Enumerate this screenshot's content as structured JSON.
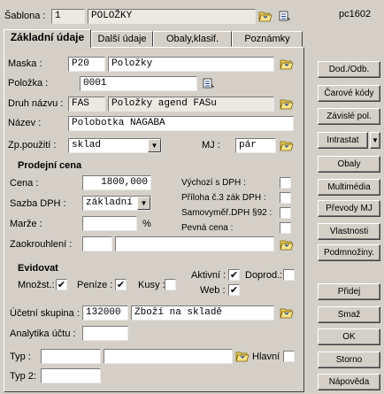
{
  "header": {
    "sablona_label": "Šablona :",
    "sablona_number": "1",
    "sablona_name": "POLOŽKY",
    "code": "pc1602"
  },
  "tabs": [
    {
      "label": "Základní údaje"
    },
    {
      "label": "Další údaje"
    },
    {
      "label": "Obaly,klasif."
    },
    {
      "label": "Poznámky"
    }
  ],
  "form": {
    "maska_label": "Maska :",
    "maska_code": "P20",
    "maska_name": "Položky",
    "polozka_label": "Položka :",
    "polozka_value": "0001",
    "druh_label": "Druh názvu :",
    "druh_code": "FAS",
    "druh_name": "Položky agend FASu",
    "nazev_label": "Název :",
    "nazev_value": "Polobotka NAGABA",
    "zp_pouziti_label": "Zp.použití :",
    "zp_pouziti_value": "sklad",
    "mj_label": "MJ :",
    "mj_value": "pár"
  },
  "prodejni_cena": {
    "title": "Prodejní cena",
    "cena_label": "Cena :",
    "cena_value": "1800,000",
    "sazba_label": "Sazba DPH :",
    "sazba_value": "základní",
    "marze_label": "Marže :",
    "marze_unit": "%",
    "zaokrouhleni_label": "Zaokrouhlení :",
    "vychozi_label": "Výchozí s DPH :",
    "priloha_label": "Příloha č.3 zák DPH :",
    "samovymer_label": "Samovyměř.DPH §92 :",
    "pevna_label": "Pevná cena :"
  },
  "evidovat": {
    "title": "Evidovat",
    "mnozst_label": "Množst.:",
    "mnozst_checked": true,
    "penize_label": "Peníze :",
    "penize_checked": true,
    "kusy_label": "Kusy :",
    "kusy_checked": false,
    "aktivni_label": "Aktivní :",
    "aktivni_checked": true,
    "doprod_label": "Doprod.:",
    "doprod_checked": false,
    "web_label": "Web :",
    "web_checked": true
  },
  "ucetni": {
    "skupina_label": "Účetní skupina :",
    "skupina_code": "132000",
    "skupina_name": "Zboží na skladě",
    "analytika_label": "Analytika účtu :",
    "typ_label": "Typ :",
    "hlavni_label": "Hlavní",
    "typ2_label": "Typ 2:"
  },
  "buttons": {
    "dod_odb": "Dod./Odb.",
    "carove_kody": "Čarové kódy",
    "zavisle_pol": "Závislé pol.",
    "intrastat": "Intrastat",
    "obaly": "Obaly",
    "multimedia": "Multimédia",
    "prevody_mj": "Převody MJ",
    "vlastnosti": "Vlastnosti",
    "podmnoziny": "Podmnožiny.",
    "pridej": "Přidej",
    "smaz": "Smaž",
    "ok": "OK",
    "storno": "Storno",
    "napoveda": "Nápověda"
  },
  "icons": {
    "folder": "folder-open-icon",
    "tool": "list-tool-icon",
    "dropdown": "triangle-down"
  }
}
